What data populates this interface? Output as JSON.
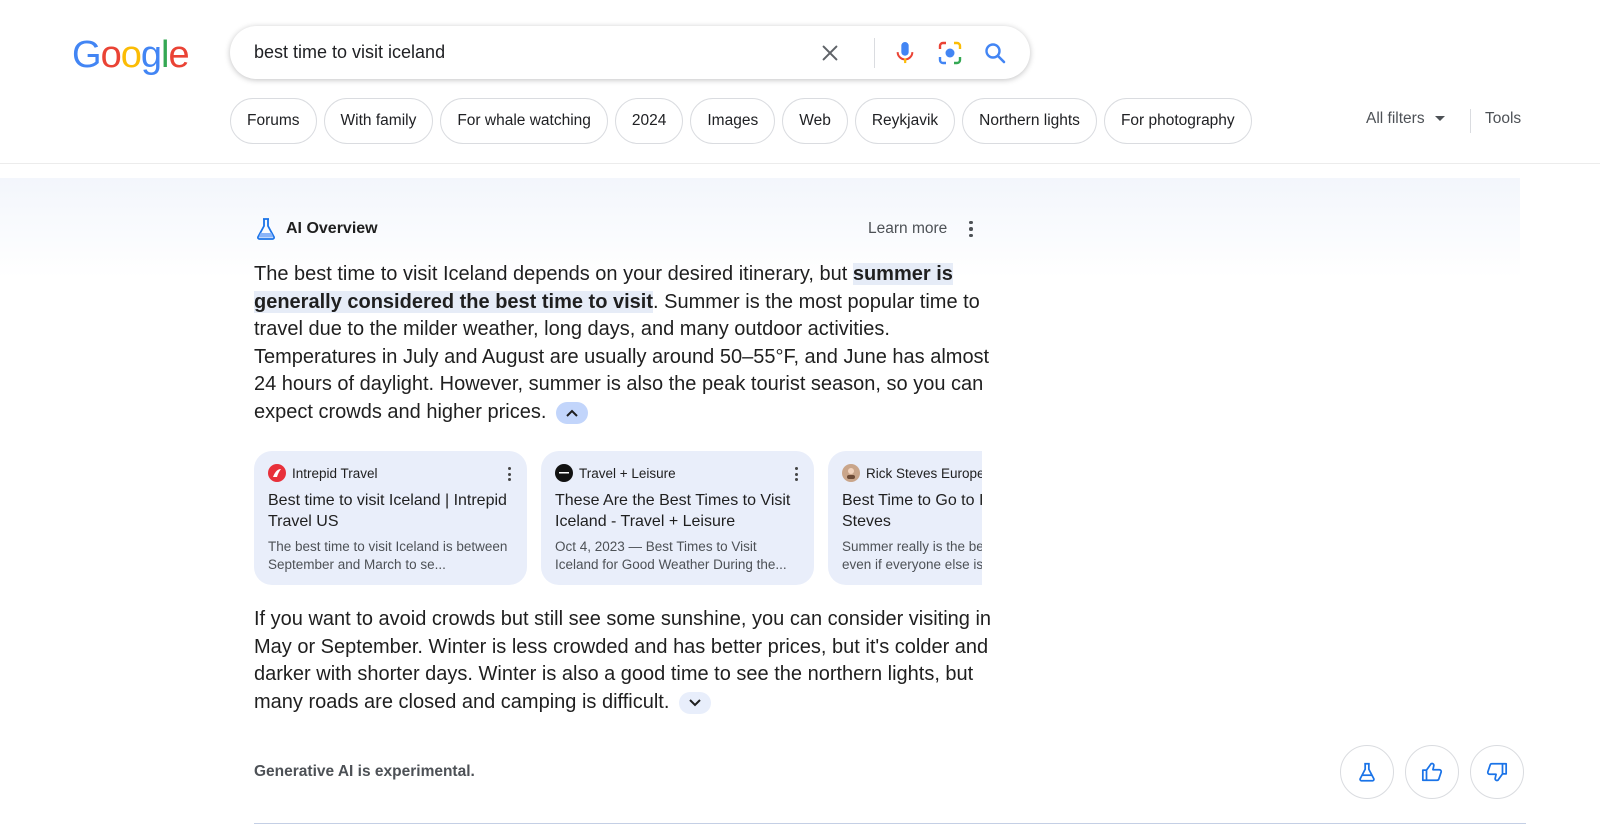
{
  "logo": {
    "letters": [
      "G",
      "o",
      "o",
      "g",
      "l",
      "e"
    ],
    "colors": [
      "#4285F4",
      "#EA4335",
      "#FBBC05",
      "#4285F4",
      "#34A853",
      "#EA4335"
    ]
  },
  "search": {
    "query": "best time to visit iceland"
  },
  "icons": {
    "clear": "close-icon",
    "voice": "microphone-icon",
    "lens": "lens-icon",
    "search": "search-icon"
  },
  "chips": [
    "Forums",
    "With family",
    "For whale watching",
    "2024",
    "Images",
    "Web",
    "Reykjavik",
    "Northern lights",
    "For photography"
  ],
  "filters": {
    "all_filters": "All filters",
    "tools": "Tools"
  },
  "ai_overview": {
    "title": "AI Overview",
    "learn_more": "Learn more",
    "para1_before": "The best time to visit Iceland depends on your desired itinerary, but ",
    "para1_highlight": "summer is generally considered the best time to visit",
    "para1_after": ". Summer is the most popular time to travel due to the milder weather, long days, and many outdoor activities. Temperatures in July and August are usually around 50–55°F, and June has almost 24 hours of daylight. However, summer is also the peak tourist season, so you can expect crowds and higher prices.",
    "para2": "If you want to avoid crowds but still see some sunshine, you can consider visiting in May or September. Winter is less crowded and has better prices, but it's colder and darker with shorter days. Winter is also a good time to see the northern lights, but many roads are closed and camping is difficult.",
    "footer": "Generative AI is experimental.",
    "accent": "#1a73e8"
  },
  "cards": [
    {
      "source": "Intrepid Travel",
      "title": "Best time to visit Iceland | Intrepid Travel US",
      "snippet": "The best time to visit Iceland is between September and March to se..."
    },
    {
      "source": "Travel + Leisure",
      "title": "These Are the Best Times to Visit Iceland - Travel + Leisure",
      "snippet": "Oct 4, 2023 — Best Times to Visit Iceland for Good Weather During the..."
    },
    {
      "source": "Rick Steves Europe",
      "title": "Best Time to Go to Iceland | Rick Steves",
      "snippet": "Summer really is the best time to visit, even if everyone else is..."
    }
  ]
}
